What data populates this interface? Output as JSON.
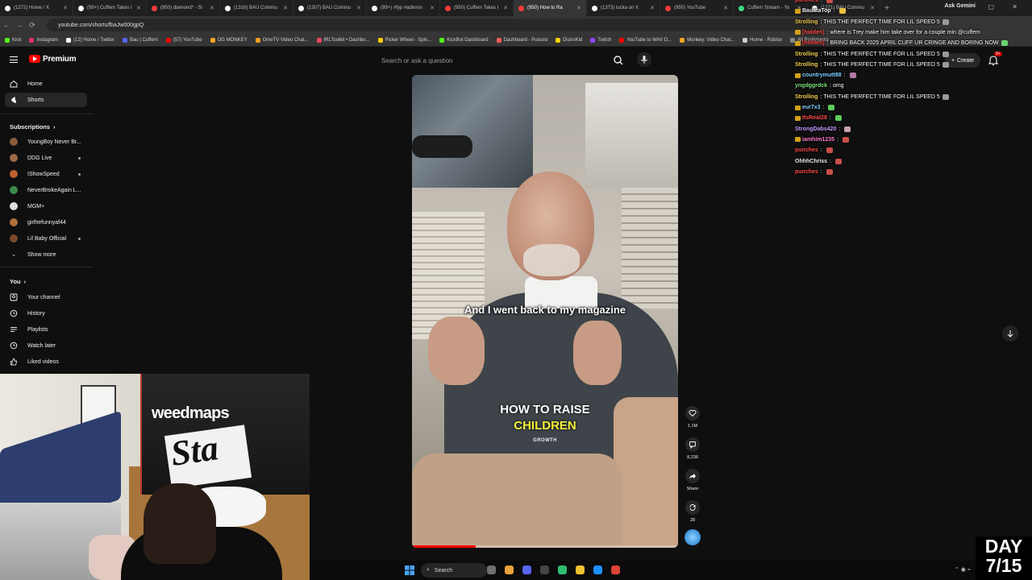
{
  "browser": {
    "tabs": [
      {
        "title": "(1272) Home / X",
        "favicon_color": "#ffffff"
      },
      {
        "title": "(99+) Cuffem Takes I",
        "favicon_color": "#ffffff"
      },
      {
        "title": "(950) diamond* - Sl",
        "favicon_color": "#ff3b3b"
      },
      {
        "title": "(1316) BAU Commu",
        "favicon_color": "#ffffff"
      },
      {
        "title": "(1307) BAU Commu",
        "favicon_color": "#ffffff"
      },
      {
        "title": "(99+) #fyp #adinros",
        "favicon_color": "#ffffff"
      },
      {
        "title": "(950) Cuffem Takes I",
        "favicon_color": "#ff3b3b"
      },
      {
        "title": "(950) How to Ra",
        "favicon_color": "#ff3b3b",
        "active": true
      },
      {
        "title": "(1373) lucka on X",
        "favicon_color": "#ffffff"
      },
      {
        "title": "(950) YouTube",
        "favicon_color": "#ff3b3b"
      },
      {
        "title": "Cuffem Stream - Yo",
        "favicon_color": "#3ddc84"
      },
      {
        "title": "(1371) BAU Commu",
        "favicon_color": "#ffffff"
      }
    ],
    "ask_gemini": "Ask Gemini",
    "url": "youtube.com/shorts/fbaJw000gpQ",
    "bookmarks": [
      {
        "label": "Kick",
        "color": "#53fc18"
      },
      {
        "label": "Instagram",
        "color": "#e1306c"
      },
      {
        "label": "(12) Home / Twitter",
        "color": "#ffffff"
      },
      {
        "label": "Bau | Cuffem",
        "color": "#5865f2"
      },
      {
        "label": "(57) YouTube",
        "color": "#ff0000"
      },
      {
        "label": "OG MONKEY",
        "color": "#f5a623"
      },
      {
        "label": "OmeTV Video Chat...",
        "color": "#ff9f1c"
      },
      {
        "label": "IRLToolkit • Dashbo...",
        "color": "#e94560"
      },
      {
        "label": "Picker Wheel - Spin...",
        "color": "#ffcc00"
      },
      {
        "label": "KickBot Dashboard",
        "color": "#53fc18"
      },
      {
        "label": "Dashboard - Pulsoid",
        "color": "#ff5a5a"
      },
      {
        "label": "DistroKid",
        "color": "#ffd400"
      },
      {
        "label": "Twitch",
        "color": "#9146ff"
      },
      {
        "label": "YouTube to WAV D...",
        "color": "#ff0000"
      },
      {
        "label": "Monkey: Video Chat...",
        "color": "#f5a623"
      },
      {
        "label": "Home - Roblox",
        "color": "#cccccc"
      },
      {
        "label": "All Bookmarks",
        "color": "#888888"
      }
    ]
  },
  "youtube": {
    "brand": "Premium",
    "search_placeholder": "Search or ask a question",
    "create_label": "Create",
    "notif_count": "9+",
    "sidebar": {
      "items": [
        {
          "label": "Home",
          "icon": "home-icon"
        },
        {
          "label": "Shorts",
          "icon": "shorts-icon",
          "active": true
        }
      ],
      "subscriptions_title": "Subscriptions",
      "subscriptions": [
        {
          "label": "YoungBoy Never Br...",
          "color": "#8a5a3c",
          "live": false
        },
        {
          "label": "DDG Live",
          "color": "#a06a4a",
          "live": true
        },
        {
          "label": "IShowSpeed",
          "color": "#c06030",
          "live": true
        },
        {
          "label": "NeverBrokeAgain L...",
          "color": "#3a8a4a",
          "live": false
        },
        {
          "label": "MGM+",
          "color": "#dddddd",
          "live": false
        },
        {
          "label": "girlhefunnyaf44",
          "color": "#b0703a",
          "live": false
        },
        {
          "label": "Lil Baby Official",
          "color": "#7a4a2a",
          "live": true
        }
      ],
      "show_more": "Show more",
      "you_title": "You",
      "you_items": [
        {
          "label": "Your channel",
          "icon": "account-icon"
        },
        {
          "label": "History",
          "icon": "history-icon"
        },
        {
          "label": "Playlists",
          "icon": "playlists-icon"
        },
        {
          "label": "Watch later",
          "icon": "clock-icon"
        },
        {
          "label": "Liked videos",
          "icon": "thumbs-up-icon"
        }
      ]
    },
    "short": {
      "caption": "And I went back to my magazine",
      "title_line1": "HOW TO RAISE",
      "title_line2": "CHILDREN",
      "title_line3": "GROWTH",
      "progress": 0.24,
      "actions": [
        {
          "name": "like",
          "label": "1.1M"
        },
        {
          "name": "comments",
          "label": "8,236"
        },
        {
          "name": "share",
          "label": "Share"
        },
        {
          "name": "remix",
          "label": "28"
        }
      ]
    }
  },
  "chat": [
    {
      "user": "punches",
      "text": "",
      "user_color": "#ff4b4b",
      "badge": "",
      "emote": "#c8504a"
    },
    {
      "user": "BauataTop",
      "text": "",
      "user_color": "#f0f0f0",
      "badge": "#d4a017",
      "emote": "#e8c040"
    },
    {
      "user": "Strolling",
      "text": "THIS THE PERFECT TIME FOR LIL SPEED 5",
      "user_color": "#f0d050",
      "badge": "",
      "emote": "#9a9a9a"
    },
    {
      "user": "[hidden]",
      "text": "where is Trey make him take over for a couple min @cuffem",
      "user_color": "#ff4b4b",
      "badge": "#d4a017",
      "emote": ""
    },
    {
      "user": "[hidden]",
      "text": "BRING BACK 2025 APRIL CUFF UR CRINGE AND BORING NOW",
      "user_color": "#ff4b4b",
      "badge": "#d4a017",
      "emote": "#6cd46c"
    },
    {
      "user": "Strolling",
      "text": "THIS THE PERFECT TIME FOR LIL SPEED 5",
      "user_color": "#f0d050",
      "badge": "",
      "emote": "#9a9a9a"
    },
    {
      "user": "Strolling",
      "text": "THIS THE PERFECT TIME FOR LIL SPEED 5",
      "user_color": "#f0d050",
      "badge": "",
      "emote": "#9a9a9a"
    },
    {
      "user": "countrymutt88",
      "text": "",
      "user_color": "#7fd0ff",
      "badge": "#d4a017",
      "emote": "#b07aa6"
    },
    {
      "user": "yngdggrdck",
      "text": "omg",
      "user_color": "#7ee07e",
      "badge": "",
      "emote": ""
    },
    {
      "user": "Strolling",
      "text": "THIS THE PERFECT TIME FOR LIL SPEED 5",
      "user_color": "#f0d050",
      "badge": "",
      "emote": "#9a9a9a"
    },
    {
      "user": "eur7x3",
      "text": "",
      "user_color": "#7fd0ff",
      "badge": "#d4a017",
      "emote": "#5ccc5c"
    },
    {
      "user": "ItsReal28",
      "text": "",
      "user_color": "#ff4b4b",
      "badge": "#d4a017",
      "emote": "#5ccc5c"
    },
    {
      "user": "StrongDabs420",
      "text": "",
      "user_color": "#c89cff",
      "badge": "",
      "emote": "#c9a0b0"
    },
    {
      "user": "iamhim1235",
      "text": "",
      "user_color": "#ff77c8",
      "badge": "#d4a017",
      "emote": "#c8504a"
    },
    {
      "user": "punches",
      "text": "",
      "user_color": "#ff4b4b",
      "badge": "",
      "emote": "#c8504a"
    },
    {
      "user": "OhhhChriss",
      "text": "",
      "user_color": "#f0f0f0",
      "badge": "",
      "emote": "#c8504a"
    },
    {
      "user": "punches",
      "text": "",
      "user_color": "#ff4b4b",
      "badge": "",
      "emote": "#c8504a"
    }
  ],
  "webcam": {
    "banner_text": "weedmaps",
    "sign_text": "Sta"
  },
  "overlay": {
    "day_line1": "DAY",
    "day_line2": "7/15"
  },
  "taskbar": {
    "search_label": "Search",
    "apps": [
      {
        "name": "app-1",
        "color": "#6f6f6f"
      },
      {
        "name": "chrome",
        "color": "#e8a33b"
      },
      {
        "name": "discord",
        "color": "#5865f2"
      },
      {
        "name": "app-4",
        "color": "#444444"
      },
      {
        "name": "app-5",
        "color": "#2dbd6e"
      },
      {
        "name": "explorer",
        "color": "#f1c232"
      },
      {
        "name": "app-7",
        "color": "#1e90ff"
      },
      {
        "name": "chrome-2",
        "color": "#db4437"
      }
    ]
  }
}
